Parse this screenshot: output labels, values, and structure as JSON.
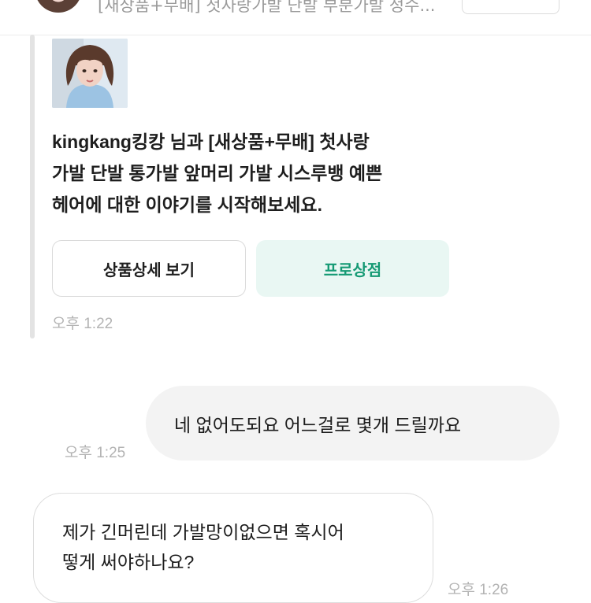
{
  "product_bar": {
    "title": "[새상품+무배] 첫사랑가발 단발 부분가발 정수..."
  },
  "system_message": {
    "text": "kingkang킹캉 님과 [새상품+무배] 첫사랑 가발 단발 통가발 앞머리 가발 시스루뱅 예쁜 헤어에 대한 이야기를 시작해보세요.",
    "lines": [
      "kingkang킹캉 님과 [새상품+무배] 첫사랑",
      "가발 단발 통가발 앞머리 가발 시스루뱅 예쁜",
      "헤어에 대한 이야기를 시작해보세요."
    ],
    "detail_button": "상품상세 보기",
    "shop_button": "프로상점",
    "time": "오후 1:22"
  },
  "messages": [
    {
      "direction": "sent",
      "lines": [
        "네 없어도되요 어느걸로 몇개 드릴까요"
      ],
      "time": "오후 1:25"
    },
    {
      "direction": "received",
      "lines": [
        "제가 긴머린데 가발망이없으면 혹시어",
        "떻게 써야하나요?"
      ],
      "time": "오후 1:26"
    }
  ],
  "colors": {
    "accent": "#159a74",
    "accent_bg": "#e9f7f3",
    "sent_bubble": "#f3f3f3",
    "time_text": "#b3b3b3"
  }
}
